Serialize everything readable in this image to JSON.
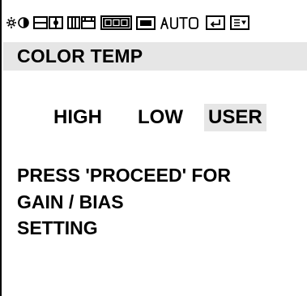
{
  "status_icons": [
    {
      "name": "brightness-contrast-icon"
    },
    {
      "name": "h-position-icon"
    },
    {
      "name": "v-position-icon"
    },
    {
      "name": "rgb-icon",
      "label": "RGB"
    },
    {
      "name": "screen-icon"
    },
    {
      "name": "auto-icon",
      "label": "AUTO"
    },
    {
      "name": "exit-icon"
    },
    {
      "name": "menu-icon"
    }
  ],
  "menu": {
    "title": "COLOR TEMP"
  },
  "options": {
    "high": "HIGH",
    "low": "LOW",
    "user": "USER",
    "selected": "USER"
  },
  "message": {
    "line1": "PRESS 'PROCEED' FOR",
    "line2": "GAIN / BIAS",
    "line3": "SETTING"
  },
  "colors": {
    "highlight": "#e6e6e6",
    "text": "#000000",
    "background": "#ffffff"
  }
}
